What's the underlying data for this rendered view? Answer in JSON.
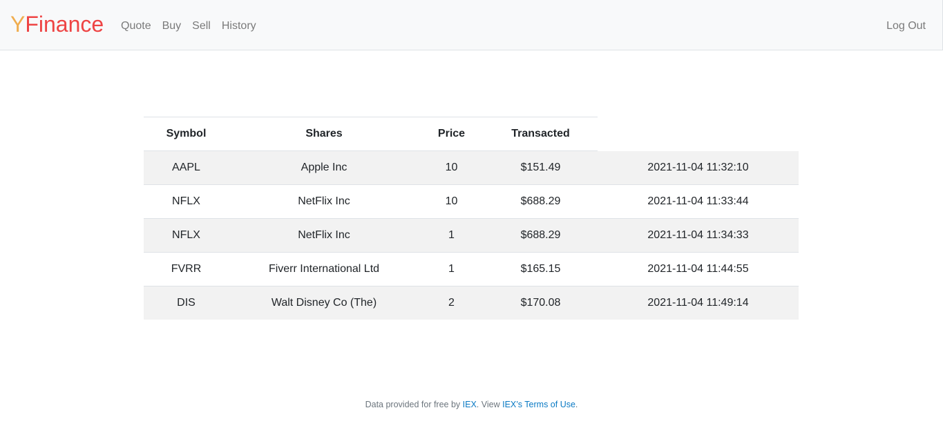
{
  "nav": {
    "brand_y": "Y",
    "brand_rest": "Finance",
    "links": [
      "Quote",
      "Buy",
      "Sell",
      "History"
    ],
    "logout": "Log Out"
  },
  "table": {
    "headers": [
      "Symbol",
      "Shares",
      "Price",
      "Transacted"
    ],
    "rows": [
      {
        "symbol": "AAPL",
        "name": "Apple Inc",
        "shares": "10",
        "price": "$151.49",
        "transacted": "2021-11-04 11:32:10"
      },
      {
        "symbol": "NFLX",
        "name": "NetFlix Inc",
        "shares": "10",
        "price": "$688.29",
        "transacted": "2021-11-04 11:33:44"
      },
      {
        "symbol": "NFLX",
        "name": "NetFlix Inc",
        "shares": "1",
        "price": "$688.29",
        "transacted": "2021-11-04 11:34:33"
      },
      {
        "symbol": "FVRR",
        "name": "Fiverr International Ltd",
        "shares": "1",
        "price": "$165.15",
        "transacted": "2021-11-04 11:44:55"
      },
      {
        "symbol": "DIS",
        "name": "Walt Disney Co (The)",
        "shares": "2",
        "price": "$170.08",
        "transacted": "2021-11-04 11:49:14"
      }
    ]
  },
  "footer": {
    "prefix": "Data provided for free by ",
    "iex_link": "IEX",
    "middle": ". View ",
    "terms_link": "IEX’s Terms of Use",
    "suffix": "."
  }
}
